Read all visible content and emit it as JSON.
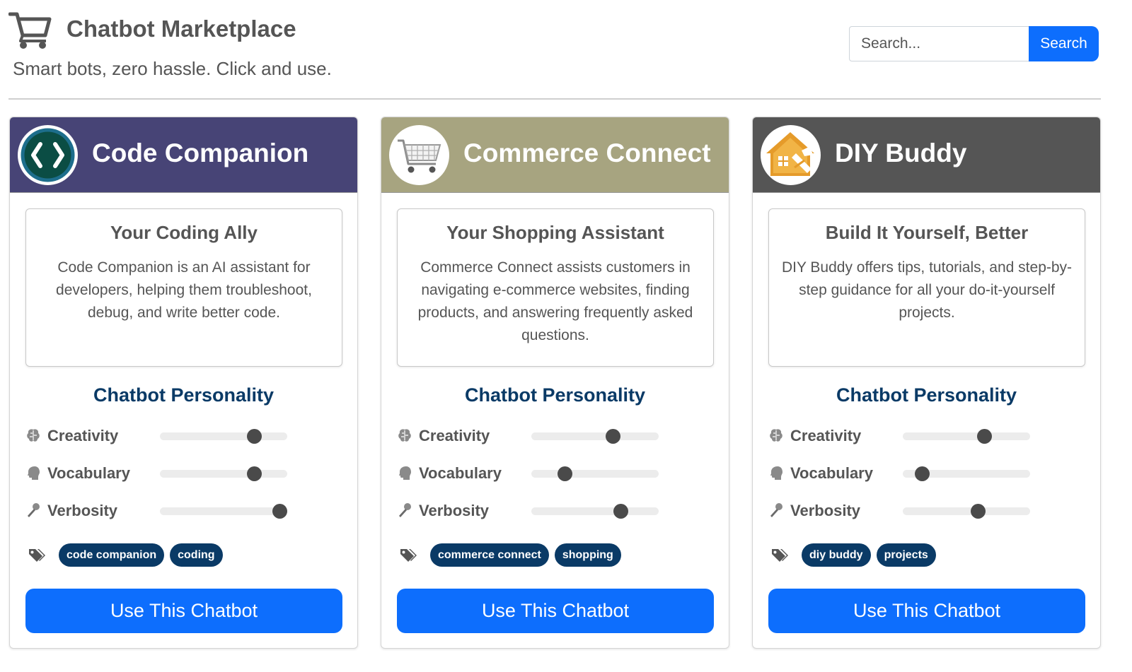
{
  "header": {
    "title": "Chatbot Marketplace",
    "tagline": "Smart bots, zero hassle. Click and use.",
    "icon": "shopping-cart-icon",
    "search_placeholder": "Search...",
    "search_button": "Search"
  },
  "colors": {
    "primary": "#0d6efd",
    "heading": "#0a3a66",
    "tag": "#0a3a66",
    "card_headers": [
      "#474476",
      "#a7a480",
      "#555555"
    ]
  },
  "cards": [
    {
      "name": "Code Companion",
      "logo": "code-brackets-logo",
      "description_title": "Your Coding Ally",
      "description": "Code Companion is an AI assistant for developers, helping them troubleshoot, debug, and write better code.",
      "personality_heading": "Chatbot Personality",
      "traits": [
        {
          "label": "Creativity",
          "icon": "brain-icon",
          "value": 0.74
        },
        {
          "label": "Vocabulary",
          "icon": "head-icon",
          "value": 0.74
        },
        {
          "label": "Verbosity",
          "icon": "microphone-icon",
          "value": 0.94
        }
      ],
      "tags": [
        "code companion",
        "coding"
      ],
      "button": "Use This Chatbot"
    },
    {
      "name": "Commerce Connect",
      "logo": "shopping-cart-logo",
      "description_title": "Your Shopping Assistant",
      "description": "Commerce Connect assists customers in navigating e-commerce websites, finding products, and answering frequently asked questions.",
      "personality_heading": "Chatbot Personality",
      "traits": [
        {
          "label": "Creativity",
          "icon": "brain-icon",
          "value": 0.64
        },
        {
          "label": "Vocabulary",
          "icon": "head-icon",
          "value": 0.26
        },
        {
          "label": "Verbosity",
          "icon": "microphone-icon",
          "value": 0.7
        }
      ],
      "tags": [
        "commerce connect",
        "shopping"
      ],
      "button": "Use This Chatbot"
    },
    {
      "name": "DIY Buddy",
      "logo": "house-tools-logo",
      "description_title": "Build It Yourself, Better",
      "description": "DIY Buddy offers tips, tutorials, and step-by-step guidance for all your do-it-yourself projects.",
      "personality_heading": "Chatbot Personality",
      "traits": [
        {
          "label": "Creativity",
          "icon": "brain-icon",
          "value": 0.64
        },
        {
          "label": "Vocabulary",
          "icon": "head-icon",
          "value": 0.15
        },
        {
          "label": "Verbosity",
          "icon": "microphone-icon",
          "value": 0.59
        }
      ],
      "tags": [
        "diy buddy",
        "projects"
      ],
      "button": "Use This Chatbot"
    }
  ]
}
